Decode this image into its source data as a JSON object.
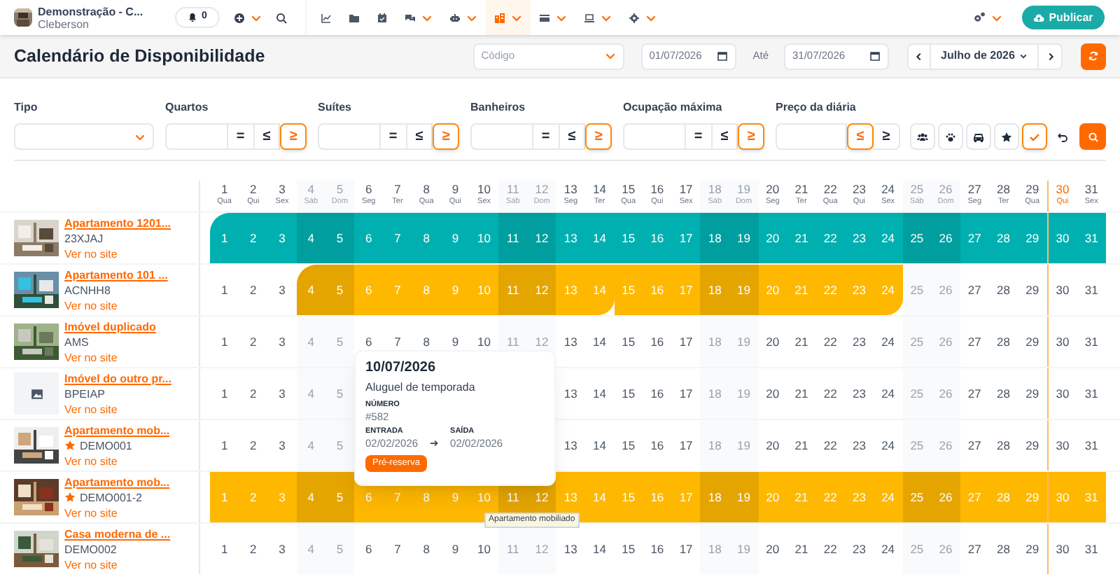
{
  "topbar": {
    "account": {
      "name": "Demonstração - C...",
      "user": "Cleberson"
    },
    "notifications": "0",
    "nav_items": [
      {
        "caret": false,
        "selected": false
      },
      {
        "caret": false,
        "selected": false
      },
      {
        "caret": false,
        "selected": false
      },
      {
        "caret": true,
        "selected": false
      },
      {
        "caret": true,
        "selected": false
      },
      {
        "caret": true,
        "selected": true
      },
      {
        "caret": true,
        "selected": false
      },
      {
        "caret": true,
        "selected": false
      },
      {
        "caret": true,
        "selected": false
      }
    ],
    "publish_button": "Publicar"
  },
  "header": {
    "title": "Calendário de Disponibilidade",
    "code_select": {
      "placeholder": "Código"
    },
    "date_from": "01/07/2026",
    "until_label": "Até",
    "date_to": "31/07/2026",
    "month": "Julho de 2026"
  },
  "filters": {
    "type": {
      "label": "Tipo"
    },
    "groups": [
      {
        "label": "Quartos",
        "operators": [
          {
            "symbol": "=",
            "selected": false
          },
          {
            "symbol": "≤",
            "selected": false
          },
          {
            "symbol": "≥",
            "selected": true
          }
        ]
      },
      {
        "label": "Suítes",
        "operators": [
          {
            "symbol": "=",
            "selected": false
          },
          {
            "symbol": "≤",
            "selected": false
          },
          {
            "symbol": "≥",
            "selected": true
          }
        ]
      },
      {
        "label": "Banheiros",
        "operators": [
          {
            "symbol": "=",
            "selected": false
          },
          {
            "symbol": "≤",
            "selected": false
          },
          {
            "symbol": "≥",
            "selected": true
          }
        ]
      },
      {
        "label": "Ocupação máxima",
        "operators": [
          {
            "symbol": "=",
            "selected": false
          },
          {
            "symbol": "≤",
            "selected": false
          },
          {
            "symbol": "≥",
            "selected": true
          }
        ]
      },
      {
        "label": "Preço da diária",
        "operators": [
          {
            "symbol": "≤",
            "selected": true
          },
          {
            "symbol": "≥",
            "selected": false
          }
        ]
      }
    ],
    "toggles": [
      {
        "selected": false
      },
      {
        "selected": false
      },
      {
        "selected": false
      },
      {
        "selected": false
      },
      {
        "selected": true
      }
    ]
  },
  "calendar": {
    "days": [
      {
        "day": "1",
        "weekday": "Qua",
        "weekend": false,
        "today": false
      },
      {
        "day": "2",
        "weekday": "Qui",
        "weekend": false,
        "today": false
      },
      {
        "day": "3",
        "weekday": "Sex",
        "weekend": false,
        "today": false
      },
      {
        "day": "4",
        "weekday": "Sáb",
        "weekend": true,
        "today": false
      },
      {
        "day": "5",
        "weekday": "Dom",
        "weekend": true,
        "today": false
      },
      {
        "day": "6",
        "weekday": "Seg",
        "weekend": false,
        "today": false
      },
      {
        "day": "7",
        "weekday": "Ter",
        "weekend": false,
        "today": false
      },
      {
        "day": "8",
        "weekday": "Qua",
        "weekend": false,
        "today": false
      },
      {
        "day": "9",
        "weekday": "Qui",
        "weekend": false,
        "today": false
      },
      {
        "day": "10",
        "weekday": "Sex",
        "weekend": false,
        "today": false
      },
      {
        "day": "11",
        "weekday": "Sáb",
        "weekend": true,
        "today": false
      },
      {
        "day": "12",
        "weekday": "Dom",
        "weekend": true,
        "today": false
      },
      {
        "day": "13",
        "weekday": "Seg",
        "weekend": false,
        "today": false
      },
      {
        "day": "14",
        "weekday": "Ter",
        "weekend": false,
        "today": false
      },
      {
        "day": "15",
        "weekday": "Qua",
        "weekend": false,
        "today": false
      },
      {
        "day": "16",
        "weekday": "Qui",
        "weekend": false,
        "today": false
      },
      {
        "day": "17",
        "weekday": "Sex",
        "weekend": false,
        "today": false
      },
      {
        "day": "18",
        "weekday": "Sáb",
        "weekend": true,
        "today": false
      },
      {
        "day": "19",
        "weekday": "Dom",
        "weekend": true,
        "today": false
      },
      {
        "day": "20",
        "weekday": "Seg",
        "weekend": false,
        "today": false
      },
      {
        "day": "21",
        "weekday": "Ter",
        "weekend": false,
        "today": false
      },
      {
        "day": "22",
        "weekday": "Qua",
        "weekend": false,
        "today": false
      },
      {
        "day": "23",
        "weekday": "Qui",
        "weekend": false,
        "today": false
      },
      {
        "day": "24",
        "weekday": "Sex",
        "weekend": false,
        "today": false
      },
      {
        "day": "25",
        "weekday": "Sáb",
        "weekend": true,
        "today": false
      },
      {
        "day": "26",
        "weekday": "Dom",
        "weekend": true,
        "today": false
      },
      {
        "day": "27",
        "weekday": "Seg",
        "weekend": false,
        "today": false
      },
      {
        "day": "28",
        "weekday": "Ter",
        "weekend": false,
        "today": false
      },
      {
        "day": "29",
        "weekday": "Qua",
        "weekend": false,
        "today": false
      },
      {
        "day": "30",
        "weekday": "Qui",
        "weekend": false,
        "today": true
      },
      {
        "day": "31",
        "weekday": "Sex",
        "weekend": false,
        "today": false
      }
    ],
    "rows": [
      {
        "name": "Apartamento 1201...",
        "code": "23XJAJ",
        "starred": false,
        "link": "Ver no site",
        "image": {
          "kind": "picture"
        },
        "bookings": [
          {
            "color": "#00b0b0",
            "rounded_start": true,
            "rounded_end": false
          }
        ],
        "booked": [
          true,
          true,
          true,
          true,
          true,
          true,
          true,
          true,
          true,
          true,
          true,
          true,
          true,
          true,
          true,
          true,
          true,
          true,
          true,
          true,
          true,
          true,
          true,
          true,
          true,
          true,
          true,
          true,
          true,
          true,
          true
        ],
        "booking_start": [
          true,
          false,
          false,
          false,
          false,
          false,
          false,
          false,
          false,
          false,
          false,
          false,
          false,
          false,
          false,
          false,
          false,
          false,
          false,
          false,
          false,
          false,
          false,
          false,
          false,
          false,
          false,
          false,
          false,
          false,
          false
        ],
        "cells": [
          "1",
          "2",
          "3",
          "4",
          "5",
          "6",
          "7",
          "8",
          "9",
          "10",
          "11",
          "12",
          "13",
          "14",
          "15",
          "16",
          "17",
          "18",
          "19",
          "20",
          "21",
          "22",
          "23",
          "24",
          "25",
          "26",
          "27",
          "28",
          "29",
          "30",
          "31"
        ]
      },
      {
        "name": "Apartamento 101 ...",
        "code": "ACNHH8",
        "starred": false,
        "link": "Ver no site",
        "image": {
          "kind": "picture"
        },
        "bookings": [
          {
            "color": "#ffb800",
            "rounded_start": true,
            "rounded_end": true
          },
          {
            "color": "#ffb800",
            "rounded_start": false,
            "rounded_end": true
          }
        ],
        "booked": [
          false,
          false,
          false,
          true,
          true,
          true,
          true,
          true,
          true,
          true,
          true,
          true,
          true,
          true,
          true,
          true,
          true,
          true,
          true,
          true,
          true,
          true,
          true,
          true,
          false,
          false,
          false,
          false,
          false,
          false,
          false
        ],
        "booking_start": [
          false,
          false,
          false,
          true,
          false,
          false,
          false,
          false,
          false,
          false,
          false,
          false,
          false,
          false,
          true,
          false,
          false,
          false,
          false,
          false,
          false,
          false,
          false,
          false,
          false,
          false,
          false,
          false,
          false,
          false,
          false
        ],
        "cells": [
          "1",
          "2",
          "3",
          "4",
          "5",
          "6",
          "7",
          "8",
          "9",
          "10",
          "11",
          "12",
          "13",
          "14",
          "15",
          "16",
          "17",
          "18",
          "19",
          "20",
          "21",
          "22",
          "23",
          "24",
          "25",
          "26",
          "27",
          "28",
          "29",
          "30",
          "31"
        ]
      },
      {
        "name": "Imóvel duplicado",
        "code": "AMS",
        "starred": false,
        "link": "Ver no site",
        "image": {
          "kind": "picture"
        },
        "bookings": [],
        "cells": [
          "1",
          "2",
          "3",
          "4",
          "5",
          "6",
          "7",
          "8",
          "9",
          "10",
          "11",
          "12",
          "13",
          "14",
          "15",
          "16",
          "17",
          "18",
          "19",
          "20",
          "21",
          "22",
          "23",
          "24",
          "25",
          "26",
          "27",
          "28",
          "29",
          "30",
          "31"
        ]
      },
      {
        "name": "Imóvel do outro pr...",
        "code": "BPEIAP",
        "starred": false,
        "link": "Ver no site",
        "image": {
          "kind": "placeholder"
        },
        "bookings": [],
        "cells": [
          "1",
          "2",
          "3",
          "4",
          "5",
          null,
          null,
          null,
          null,
          null,
          null,
          null,
          "13",
          "14",
          "15",
          "16",
          "17",
          "18",
          "19",
          "20",
          "21",
          "22",
          "23",
          "24",
          "25",
          "26",
          "27",
          "28",
          "29",
          "30",
          "31"
        ]
      },
      {
        "name": "Apartamento mob...",
        "code": "DEMO001",
        "starred": true,
        "link": "Ver no site",
        "image": {
          "kind": "picture"
        },
        "bookings": [],
        "cells": [
          "1",
          "2",
          "3",
          "4",
          "5",
          null,
          null,
          null,
          null,
          null,
          null,
          null,
          "13",
          "14",
          "15",
          "16",
          "17",
          "18",
          "19",
          "20",
          "21",
          "22",
          "23",
          "24",
          "25",
          "26",
          "27",
          "28",
          "29",
          "30",
          "31"
        ]
      },
      {
        "name": "Apartamento mob...",
        "code": "DEMO001-2",
        "starred": true,
        "link": "Ver no site",
        "image": {
          "kind": "picture"
        },
        "bookings": [
          {
            "color": "#ffb800",
            "rounded_start": false,
            "rounded_end": false
          }
        ],
        "booked": [
          true,
          true,
          true,
          true,
          true,
          true,
          true,
          true,
          true,
          true,
          true,
          true,
          true,
          true,
          true,
          true,
          true,
          true,
          true,
          true,
          true,
          true,
          true,
          true,
          true,
          true,
          true,
          true,
          true,
          true,
          true
        ],
        "booking_start": [
          false,
          false,
          false,
          false,
          false,
          false,
          false,
          false,
          false,
          false,
          false,
          false,
          false,
          false,
          false,
          false,
          false,
          false,
          false,
          false,
          false,
          false,
          false,
          false,
          false,
          false,
          false,
          false,
          false,
          false,
          false
        ],
        "cells": [
          "1",
          "2",
          "3",
          "4",
          "5",
          "6",
          "7",
          "8",
          "9",
          "10",
          "11",
          "12",
          "13",
          "14",
          "15",
          "16",
          "17",
          "18",
          "19",
          "20",
          "21",
          "22",
          "23",
          "24",
          "25",
          "26",
          "27",
          "28",
          "29",
          "30",
          "31"
        ]
      },
      {
        "name": "Casa moderna de ...",
        "code": "DEMO002",
        "starred": false,
        "link": "Ver no site",
        "image": {
          "kind": "picture"
        },
        "bookings": [],
        "cells": [
          "1",
          "2",
          "3",
          "4",
          "5",
          "6",
          "7",
          "8",
          "9",
          "10",
          "11",
          "12",
          "13",
          "14",
          "15",
          "16",
          "17",
          "18",
          "19",
          "20",
          "21",
          "22",
          "23",
          "24",
          "25",
          "26",
          "27",
          "28",
          "29",
          "30",
          "31"
        ]
      }
    ]
  },
  "popover": {
    "date": "10/07/2026",
    "type": "Aluguel de temporada",
    "number_label": "NÚMERO",
    "number": "#582",
    "checkin_label": "ENTRADA",
    "checkin": "02/02/2026",
    "checkout_label": "SAÍDA",
    "checkout": "02/02/2026",
    "badge": "Pré-reserva"
  },
  "hover_tooltip": "Apartamento mobiliado"
}
